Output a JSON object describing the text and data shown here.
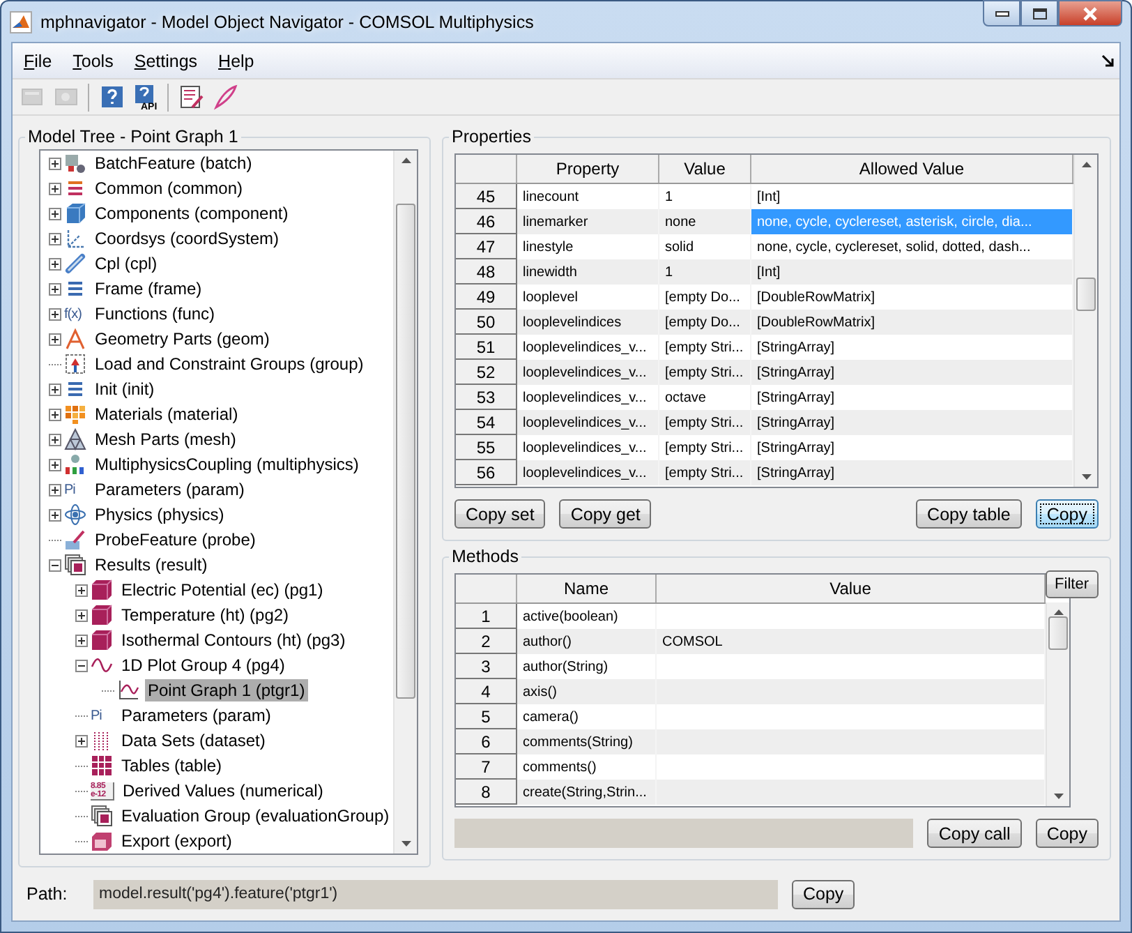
{
  "window": {
    "title": "mphnavigator - Model Object Navigator - COMSOL Multiphysics"
  },
  "menu": [
    {
      "label": "File"
    },
    {
      "label": "Tools"
    },
    {
      "label": "Settings"
    },
    {
      "label": "Help"
    }
  ],
  "toolbar": [
    {
      "kind": "disabled-a",
      "disabled": true
    },
    {
      "kind": "disabled-b",
      "disabled": true
    },
    {
      "kind": "help",
      "disabled": false
    },
    {
      "kind": "help-api",
      "disabled": false,
      "badge": "API"
    },
    {
      "kind": "list-edit",
      "disabled": false
    },
    {
      "kind": "feather",
      "disabled": false
    }
  ],
  "tree": {
    "title": "Model Tree - Point Graph 1",
    "items": [
      {
        "label": "BatchFeature (batch)",
        "kind": "batch",
        "expanded": false,
        "selected": false
      },
      {
        "label": "Common (common)",
        "kind": "lines-red",
        "expanded": false,
        "selected": false
      },
      {
        "label": "Components (component)",
        "kind": "cube-blue",
        "expanded": false,
        "selected": false
      },
      {
        "label": "Coordsys (coordSystem)",
        "kind": "axes",
        "expanded": false,
        "selected": false
      },
      {
        "label": "Cpl (cpl)",
        "kind": "link",
        "expanded": false,
        "selected": false
      },
      {
        "label": "Frame (frame)",
        "kind": "lines-blue",
        "expanded": false,
        "selected": false
      },
      {
        "label": "Functions (func)",
        "kind": "glyph",
        "icon_text": "f(x)",
        "expanded": false,
        "selected": false
      },
      {
        "label": "Geometry Parts (geom)",
        "kind": "geom",
        "expanded": false,
        "selected": false
      },
      {
        "label": "Load and Constraint Groups (group)",
        "kind": "group",
        "selected": false
      },
      {
        "label": "Init (init)",
        "kind": "lines-blue",
        "expanded": false,
        "selected": false
      },
      {
        "label": "Materials (material)",
        "kind": "materials",
        "expanded": false,
        "selected": false
      },
      {
        "label": "Mesh Parts (mesh)",
        "kind": "mesh",
        "expanded": false,
        "selected": false
      },
      {
        "label": "MultiphysicsCoupling (multiphysics)",
        "kind": "multiphysics",
        "expanded": false,
        "selected": false
      },
      {
        "label": "Parameters (param)",
        "kind": "glyph",
        "icon_text": "Pi",
        "expanded": false,
        "selected": false
      },
      {
        "label": "Physics (physics)",
        "kind": "atom",
        "expanded": false,
        "selected": false
      },
      {
        "label": "ProbeFeature (probe)",
        "kind": "probe",
        "selected": false
      },
      {
        "label": "Results (result)",
        "kind": "results",
        "expanded": true,
        "selected": false,
        "children": [
          {
            "label": "Electric Potential (ec) (pg1)",
            "kind": "cube-magenta",
            "expanded": false,
            "selected": false
          },
          {
            "label": "Temperature (ht) (pg2)",
            "kind": "cube-magenta",
            "expanded": false,
            "selected": false
          },
          {
            "label": "Isothermal Contours (ht) (pg3)",
            "kind": "cube-magenta",
            "expanded": false,
            "selected": false
          },
          {
            "label": "1D Plot Group 4 (pg4)",
            "kind": "wave",
            "expanded": true,
            "selected": false,
            "children": [
              {
                "label": "Point Graph 1 (ptgr1)",
                "kind": "graph",
                "selected": true
              }
            ]
          },
          {
            "label": "Parameters (param)",
            "kind": "glyph",
            "icon_text": "Pi",
            "selected": false
          },
          {
            "label": "Data Sets (dataset)",
            "kind": "dots",
            "expanded": false,
            "selected": false
          },
          {
            "label": "Tables (table)",
            "kind": "table",
            "selected": false
          },
          {
            "label": "Derived Values (numerical)",
            "kind": "numeric",
            "icon_text": "8.85 e-12",
            "selected": false
          },
          {
            "label": "Evaluation Group (evaluationGroup)",
            "kind": "results",
            "selected": false
          },
          {
            "label": "Export (export)",
            "kind": "export",
            "selected": false
          }
        ]
      }
    ]
  },
  "properties": {
    "title": "Properties",
    "columns": [
      "Property",
      "Value",
      "Allowed Value"
    ],
    "rows": [
      {
        "index": "45",
        "property": "linecount",
        "value": "1",
        "allowed": "[Int]",
        "selected": false
      },
      {
        "index": "46",
        "property": "linemarker",
        "value": "none",
        "allowed": "none, cycle, cyclereset, asterisk, circle, dia...",
        "selected": true
      },
      {
        "index": "47",
        "property": "linestyle",
        "value": "solid",
        "allowed": "none, cycle, cyclereset, solid, dotted, dash...",
        "selected": false
      },
      {
        "index": "48",
        "property": "linewidth",
        "value": "1",
        "allowed": "[Int]",
        "selected": false
      },
      {
        "index": "49",
        "property": "looplevel",
        "value": "[empty Do...",
        "allowed": "[DoubleRowMatrix]",
        "selected": false
      },
      {
        "index": "50",
        "property": "looplevelindices",
        "value": "[empty Do...",
        "allowed": "[DoubleRowMatrix]",
        "selected": false
      },
      {
        "index": "51",
        "property": "looplevelindices_v...",
        "value": "[empty Stri...",
        "allowed": "[StringArray]",
        "selected": false
      },
      {
        "index": "52",
        "property": "looplevelindices_v...",
        "value": "[empty Stri...",
        "allowed": "[StringArray]",
        "selected": false
      },
      {
        "index": "53",
        "property": "looplevelindices_v...",
        "value": "octave",
        "allowed": "[StringArray]",
        "selected": false
      },
      {
        "index": "54",
        "property": "looplevelindices_v...",
        "value": "[empty Stri...",
        "allowed": "[StringArray]",
        "selected": false
      },
      {
        "index": "55",
        "property": "looplevelindices_v...",
        "value": "[empty Stri...",
        "allowed": "[StringArray]",
        "selected": false
      },
      {
        "index": "56",
        "property": "looplevelindices_v...",
        "value": "[empty Stri...",
        "allowed": "[StringArray]",
        "selected": false
      }
    ],
    "buttons": [
      {
        "label": "Copy set",
        "focused": false
      },
      {
        "label": "Copy get",
        "focused": false
      },
      {
        "label": "Copy table",
        "focused": false
      },
      {
        "label": "Copy",
        "focused": true
      }
    ]
  },
  "methods": {
    "title": "Methods",
    "columns": [
      "Name",
      "Value"
    ],
    "filter_button": "Filter",
    "rows": [
      {
        "index": "1",
        "name": "active(boolean)"
      },
      {
        "index": "2",
        "name": "author()",
        "value": "COMSOL"
      },
      {
        "index": "3",
        "name": "author(String)"
      },
      {
        "index": "4",
        "name": "axis()"
      },
      {
        "index": "5",
        "name": "camera()"
      },
      {
        "index": "6",
        "name": "comments(String)"
      },
      {
        "index": "7",
        "name": "comments()"
      },
      {
        "index": "8",
        "name": "create(String,Strin..."
      }
    ],
    "buttons": [
      {
        "label": "Copy call"
      },
      {
        "label": "Copy"
      }
    ]
  },
  "path": {
    "label": "Path:",
    "value": "model.result('pg4').feature('ptgr1')",
    "button": "Copy"
  }
}
